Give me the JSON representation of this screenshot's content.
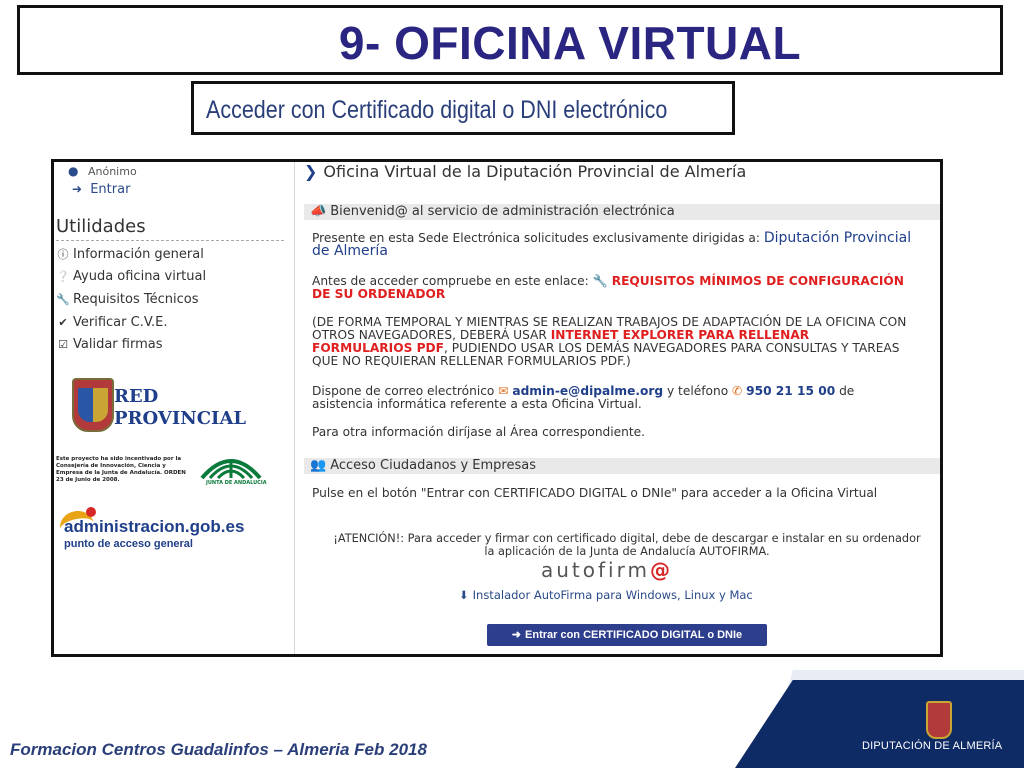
{
  "slide": {
    "title": "9- OFICINA VIRTUAL",
    "subtitle": "Acceder con Certificado digital o DNI electrónico",
    "footer": "Formacion Centros Guadalinfos – Almeria Feb 2018",
    "footer_org": "DIPUTACIÓN DE ALMERÍA"
  },
  "sidebar": {
    "user": "Anónimo",
    "enter": "Entrar",
    "utilities_title": "Utilidades",
    "items": [
      {
        "label": "Información general",
        "icon": "info-circle-icon"
      },
      {
        "label": "Ayuda oficina virtual",
        "icon": "question-circle-icon"
      },
      {
        "label": "Requisitos Técnicos",
        "icon": "wrench-icon"
      },
      {
        "label": "Verificar C.V.E.",
        "icon": "check-circle-icon"
      },
      {
        "label": "Validar firmas",
        "icon": "check-square-icon"
      }
    ],
    "logo_red": "RED\nPROVINCIAL",
    "junta_note": "Este proyecto ha sido incentivado por la Consejería de Innovación, Ciencia y Empresa de la Junta de Andalucía. ORDEN 23 de Junio de 2008.",
    "junta_logo": "JUNTA DE ANDALUCIA",
    "admin_logo": "administracion.gob.es",
    "admin_sub": "punto de acceso general"
  },
  "content": {
    "breadcrumb": "Oficina Virtual de la Diputación Provincial de Almería",
    "welcome_bar": "Bienvenid@ al servicio de administración electrónica",
    "p1_text": "Presente en esta Sede Electrónica solicitudes exclusivamente dirigidas a:",
    "p1_org": "Diputación Provincial de Almería",
    "p2_text": "Antes de acceder compruebe en este enlace:",
    "p2_link": "REQUISITOS MÍNIMOS DE CONFIGURACIÓN DE SU ORDENADOR",
    "p3_a": "(DE FORMA TEMPORAL Y MIENTRAS SE REALIZAN TRABAJOS DE ADAPTACIÓN DE LA OFICINA CON OTROS NAVEGADORES, DEBERÁ USAR",
    "p3_b": "INTERNET EXPLORER PARA RELLENAR FORMULARIOS PDF",
    "p3_c": ", PUDIENDO USAR LOS DEMÁS NAVEGADORES PARA CONSULTAS Y TAREAS QUE NO REQUIERAN RELLENAR FORMULARIOS PDF.)",
    "p4_a": "Dispone de correo electrónico",
    "p4_email": "admin-e@dipalme.org",
    "p4_b": "y teléfono",
    "p4_phone": "950 21 15 00",
    "p4_c": "de asistencia informática referente a esta Oficina Virtual.",
    "p5": "Para otra información diríjase al Área correspondiente.",
    "access_bar": "Acceso Ciudadanos y Empresas",
    "p6": "Pulse en el botón \"Entrar con CERTIFICADO DIGITAL o DNIe\" para acceder a la Oficina Virtual",
    "attention": "¡ATENCIÓN!: Para acceder y firmar con certificado digital, debe de descargar e instalar en su ordenador la aplicación de la Junta de Andalucía AUTOFIRMA.",
    "autofirma_logo": "autofirm",
    "autofirma_logo_end": "@",
    "installer": "Instalador AutoFirma para Windows, Linux y Mac",
    "enter_button": "Entrar con CERTIFICADO DIGITAL o DNIe"
  },
  "colors": {
    "title_blue": "#2a2580",
    "link_red": "#e02020",
    "button_blue": "#2c3e8c",
    "footer_navy": "#0f2b66"
  }
}
